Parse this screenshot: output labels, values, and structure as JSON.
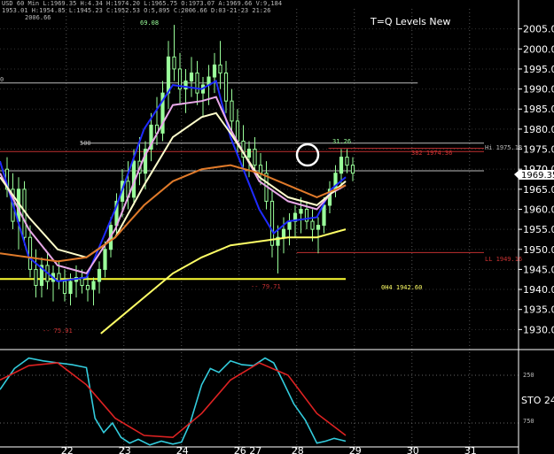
{
  "header": {
    "info_line": "USD 60 Min  L:1969.35  H:4.34  H:1974.20  L:1965.75  O:1973.07  A:1969.66  V:9,184",
    "info_line2": "1953.01  H:1954.85  L:1945.23  C:1952.53  O:5,895  C:2006.66  D:03-21-23  21:26",
    "study_title": "T=Q Levels New"
  },
  "annotations": {
    "top_left_value": "2006.66",
    "peak_value": "69.08",
    "level_500": "500",
    "level_left_top": "0",
    "low_value": "-- 75.91",
    "mid_label": "-- 79.71",
    "near_top_right": "31.26",
    "hh_label": "Hi 1975.18",
    "fib_label": "382 1974.36",
    "lo_label": "LL 1949.16",
    "pivot_label": "0H4 1942.60",
    "price_tag": "1969.35",
    "sto_label": "STO 24",
    "sto_level_top": "250",
    "sto_level_bottom": "750"
  },
  "colors": {
    "background": "#000000",
    "candle": "#9aff9a",
    "ema_blue": "#1f2bff",
    "ema_pink": "#e9a9e9",
    "ema_white": "#ffffcc",
    "ma_orange": "#e07a2a",
    "ma_yellow": "#ffff66",
    "level_red": "#c03030",
    "level_white": "#bbbbbb",
    "level_yellow": "#ffff33",
    "sto_cyan": "#33ccdd",
    "sto_red": "#dd2222"
  },
  "chart_data": [
    {
      "type": "line",
      "title": "T=Q Levels New",
      "ylim": [
        1925,
        2010
      ],
      "y_ticks": [
        1930,
        1935,
        1940,
        1945,
        1950,
        1955,
        1960,
        1965,
        1970,
        1975,
        1980,
        1985,
        1990,
        1995,
        2000,
        2005
      ],
      "y_tick_labels": [
        "1930.00",
        "1935.00",
        "1940.00",
        "1945.00",
        "1950.00",
        "1955.00",
        "1960.00",
        "1965.00",
        "1970.00",
        "1975.00",
        "1980.00",
        "1985.00",
        "1990.00",
        "1995.00",
        "2000.00",
        "2005.00"
      ],
      "x_ticks": [
        "22",
        "23",
        "24",
        "26 27",
        "28",
        "29",
        "30",
        "31"
      ],
      "x_tick_positions": [
        2.3,
        4.3,
        6.3,
        8.3,
        10.3,
        12.3,
        14.3,
        16.3
      ],
      "xlim": [
        0,
        18
      ],
      "candles": [
        {
          "x": 0.0,
          "o": 1970,
          "h": 1973,
          "l": 1963,
          "c": 1965
        },
        {
          "x": 0.2,
          "o": 1965,
          "h": 1969,
          "l": 1955,
          "c": 1957
        },
        {
          "x": 0.4,
          "o": 1957,
          "h": 1968,
          "l": 1950,
          "c": 1965
        },
        {
          "x": 0.6,
          "o": 1965,
          "h": 1967,
          "l": 1951,
          "c": 1953
        },
        {
          "x": 0.8,
          "o": 1953,
          "h": 1956,
          "l": 1943,
          "c": 1945
        },
        {
          "x": 1.0,
          "o": 1945,
          "h": 1950,
          "l": 1938,
          "c": 1941
        },
        {
          "x": 1.2,
          "o": 1941,
          "h": 1948,
          "l": 1938,
          "c": 1946
        },
        {
          "x": 1.4,
          "o": 1946,
          "h": 1949,
          "l": 1940,
          "c": 1942
        },
        {
          "x": 1.6,
          "o": 1942,
          "h": 1946,
          "l": 1937,
          "c": 1944
        },
        {
          "x": 1.8,
          "o": 1944,
          "h": 1947,
          "l": 1940,
          "c": 1942
        },
        {
          "x": 2.0,
          "o": 1942,
          "h": 1945,
          "l": 1937,
          "c": 1939
        },
        {
          "x": 2.2,
          "o": 1939,
          "h": 1944,
          "l": 1936,
          "c": 1942
        },
        {
          "x": 2.4,
          "o": 1942,
          "h": 1946,
          "l": 1938,
          "c": 1943
        },
        {
          "x": 2.6,
          "o": 1943,
          "h": 1945,
          "l": 1939,
          "c": 1941
        },
        {
          "x": 2.8,
          "o": 1941,
          "h": 1944,
          "l": 1937,
          "c": 1940
        },
        {
          "x": 3.0,
          "o": 1940,
          "h": 1943,
          "l": 1936,
          "c": 1942
        },
        {
          "x": 3.2,
          "o": 1942,
          "h": 1947,
          "l": 1939,
          "c": 1945
        },
        {
          "x": 3.4,
          "o": 1945,
          "h": 1952,
          "l": 1943,
          "c": 1950
        },
        {
          "x": 3.6,
          "o": 1950,
          "h": 1958,
          "l": 1948,
          "c": 1956
        },
        {
          "x": 3.8,
          "o": 1956,
          "h": 1964,
          "l": 1954,
          "c": 1962
        },
        {
          "x": 4.0,
          "o": 1962,
          "h": 1970,
          "l": 1958,
          "c": 1967
        },
        {
          "x": 4.2,
          "o": 1967,
          "h": 1972,
          "l": 1960,
          "c": 1963
        },
        {
          "x": 4.4,
          "o": 1963,
          "h": 1975,
          "l": 1961,
          "c": 1972
        },
        {
          "x": 4.6,
          "o": 1972,
          "h": 1978,
          "l": 1966,
          "c": 1969
        },
        {
          "x": 4.8,
          "o": 1969,
          "h": 1977,
          "l": 1965,
          "c": 1975
        },
        {
          "x": 5.0,
          "o": 1975,
          "h": 1984,
          "l": 1972,
          "c": 1981
        },
        {
          "x": 5.2,
          "o": 1981,
          "h": 1988,
          "l": 1976,
          "c": 1979
        },
        {
          "x": 5.4,
          "o": 1979,
          "h": 1992,
          "l": 1977,
          "c": 1989
        },
        {
          "x": 5.6,
          "o": 1989,
          "h": 2002,
          "l": 1985,
          "c": 1998
        },
        {
          "x": 5.8,
          "o": 1998,
          "h": 2006,
          "l": 1992,
          "c": 1995
        },
        {
          "x": 6.0,
          "o": 1995,
          "h": 1999,
          "l": 1986,
          "c": 1990
        },
        {
          "x": 6.2,
          "o": 1990,
          "h": 1995,
          "l": 1984,
          "c": 1992
        },
        {
          "x": 6.4,
          "o": 1992,
          "h": 1998,
          "l": 1988,
          "c": 1994
        },
        {
          "x": 6.6,
          "o": 1994,
          "h": 1997,
          "l": 1986,
          "c": 1989
        },
        {
          "x": 6.8,
          "o": 1989,
          "h": 1993,
          "l": 1983,
          "c": 1991
        },
        {
          "x": 7.0,
          "o": 1991,
          "h": 1996,
          "l": 1986,
          "c": 1993
        },
        {
          "x": 7.2,
          "o": 1993,
          "h": 1999,
          "l": 1989,
          "c": 1996
        },
        {
          "x": 7.4,
          "o": 1996,
          "h": 2002,
          "l": 1990,
          "c": 1994
        },
        {
          "x": 7.6,
          "o": 1994,
          "h": 1997,
          "l": 1984,
          "c": 1987
        },
        {
          "x": 7.8,
          "o": 1987,
          "h": 1990,
          "l": 1979,
          "c": 1982
        },
        {
          "x": 8.0,
          "o": 1982,
          "h": 1985,
          "l": 1974,
          "c": 1977
        },
        {
          "x": 8.2,
          "o": 1977,
          "h": 1981,
          "l": 1970,
          "c": 1973
        },
        {
          "x": 8.4,
          "o": 1973,
          "h": 1977,
          "l": 1968,
          "c": 1975
        },
        {
          "x": 8.6,
          "o": 1975,
          "h": 1978,
          "l": 1969,
          "c": 1971
        },
        {
          "x": 8.8,
          "o": 1971,
          "h": 1974,
          "l": 1966,
          "c": 1969
        },
        {
          "x": 9.0,
          "o": 1969,
          "h": 1972,
          "l": 1960,
          "c": 1962
        },
        {
          "x": 9.2,
          "o": 1962,
          "h": 1965,
          "l": 1948,
          "c": 1951
        },
        {
          "x": 9.4,
          "o": 1951,
          "h": 1956,
          "l": 1944,
          "c": 1953
        },
        {
          "x": 9.6,
          "o": 1953,
          "h": 1958,
          "l": 1949,
          "c": 1955
        },
        {
          "x": 9.8,
          "o": 1955,
          "h": 1959,
          "l": 1951,
          "c": 1957
        },
        {
          "x": 10.0,
          "o": 1957,
          "h": 1961,
          "l": 1953,
          "c": 1959
        },
        {
          "x": 10.2,
          "o": 1959,
          "h": 1963,
          "l": 1954,
          "c": 1960
        },
        {
          "x": 10.4,
          "o": 1960,
          "h": 1962,
          "l": 1955,
          "c": 1957
        },
        {
          "x": 10.6,
          "o": 1957,
          "h": 1960,
          "l": 1952,
          "c": 1955
        },
        {
          "x": 10.8,
          "o": 1955,
          "h": 1958,
          "l": 1949,
          "c": 1956
        },
        {
          "x": 11.0,
          "o": 1956,
          "h": 1963,
          "l": 1954,
          "c": 1961
        },
        {
          "x": 11.2,
          "o": 1961,
          "h": 1967,
          "l": 1959,
          "c": 1965
        },
        {
          "x": 11.4,
          "o": 1965,
          "h": 1971,
          "l": 1963,
          "c": 1969
        },
        {
          "x": 11.6,
          "o": 1969,
          "h": 1975,
          "l": 1966,
          "c": 1973
        },
        {
          "x": 11.8,
          "o": 1973,
          "h": 1975,
          "l": 1969,
          "c": 1971
        },
        {
          "x": 12.0,
          "o": 1971,
          "h": 1973,
          "l": 1967,
          "c": 1969
        }
      ],
      "series": [
        {
          "color_key": "ema_blue",
          "points": [
            [
              0,
              1972
            ],
            [
              1,
              1948
            ],
            [
              2,
              1942
            ],
            [
              3,
              1943
            ],
            [
              4,
              1960
            ],
            [
              5,
              1980
            ],
            [
              6,
              1991
            ],
            [
              7,
              1990
            ],
            [
              7.5,
              1992
            ],
            [
              8,
              1978
            ],
            [
              9,
              1960
            ],
            [
              9.5,
              1954
            ],
            [
              10,
              1957
            ],
            [
              11,
              1958
            ],
            [
              11.5,
              1965
            ],
            [
              12,
              1968
            ]
          ]
        },
        {
          "color_key": "ema_pink",
          "points": [
            [
              0,
              1969
            ],
            [
              1,
              1955
            ],
            [
              2,
              1946
            ],
            [
              3,
              1944
            ],
            [
              4,
              1955
            ],
            [
              5,
              1973
            ],
            [
              6,
              1986
            ],
            [
              7,
              1987
            ],
            [
              7.5,
              1988
            ],
            [
              8,
              1980
            ],
            [
              9,
              1967
            ],
            [
              10,
              1962
            ],
            [
              11,
              1960
            ],
            [
              11.5,
              1964
            ],
            [
              12,
              1966
            ]
          ]
        },
        {
          "color_key": "ema_white",
          "points": [
            [
              0,
              1968
            ],
            [
              1,
              1958
            ],
            [
              2,
              1950
            ],
            [
              3,
              1948
            ],
            [
              4,
              1953
            ],
            [
              5,
              1966
            ],
            [
              6,
              1978
            ],
            [
              7,
              1983
            ],
            [
              7.5,
              1984
            ],
            [
              8,
              1979
            ],
            [
              9,
              1968
            ],
            [
              10,
              1963
            ],
            [
              11,
              1961
            ],
            [
              11.5,
              1964
            ],
            [
              12,
              1967
            ]
          ]
        },
        {
          "color_key": "ma_orange",
          "points": [
            [
              0,
              1949
            ],
            [
              1,
              1948
            ],
            [
              2,
              1947
            ],
            [
              3,
              1948
            ],
            [
              4,
              1953
            ],
            [
              5,
              1961
            ],
            [
              6,
              1967
            ],
            [
              7,
              1970
            ],
            [
              8,
              1971
            ],
            [
              9,
              1969
            ],
            [
              10,
              1966
            ],
            [
              11,
              1963
            ],
            [
              12,
              1966
            ]
          ]
        },
        {
          "color_key": "ma_yellow",
          "points": [
            [
              3.5,
              1929
            ],
            [
              4,
              1932
            ],
            [
              5,
              1938
            ],
            [
              6,
              1944
            ],
            [
              7,
              1948
            ],
            [
              8,
              1951
            ],
            [
              9,
              1952
            ],
            [
              10,
              1953
            ],
            [
              11,
              1953
            ],
            [
              12,
              1955
            ]
          ]
        }
      ],
      "levels": [
        {
          "y": 1991.5,
          "x0": 0,
          "x1": 14.5,
          "color_key": "level_white",
          "width": 1
        },
        {
          "y": 1976.5,
          "x0": 2.8,
          "x1": 16.8,
          "color_key": "level_white",
          "width": 1
        },
        {
          "y": 1975.2,
          "x0": 11.4,
          "x1": 16.8,
          "color_key": "level_red",
          "width": 1
        },
        {
          "y": 1974.4,
          "x0": 0,
          "x1": 16.8,
          "color_key": "level_red",
          "width": 1
        },
        {
          "y": 1969.6,
          "x0": 0,
          "x1": 16.8,
          "color_key": "level_white",
          "width": 1
        },
        {
          "y": 1949.2,
          "x0": 10.3,
          "x1": 16.8,
          "color_key": "level_red",
          "width": 1
        },
        {
          "y": 1942.6,
          "x0": 0,
          "x1": 12.0,
          "color_key": "level_yellow",
          "width": 2
        }
      ]
    },
    {
      "type": "line",
      "title": "STO 24",
      "ylim": [
        0,
        1000
      ],
      "y_ticks": [
        250,
        750
      ],
      "y_tick_labels": [
        "250",
        "750"
      ],
      "series": [
        {
          "name": "STO",
          "color_key": "sto_cyan",
          "points": [
            [
              0,
              600
            ],
            [
              0.5,
              820
            ],
            [
              1,
              930
            ],
            [
              1.5,
              900
            ],
            [
              2,
              880
            ],
            [
              2.5,
              860
            ],
            [
              3,
              830
            ],
            [
              3.3,
              300
            ],
            [
              3.6,
              150
            ],
            [
              3.9,
              250
            ],
            [
              4.2,
              100
            ],
            [
              4.5,
              40
            ],
            [
              4.8,
              80
            ],
            [
              5.2,
              20
            ],
            [
              5.6,
              60
            ],
            [
              6,
              30
            ],
            [
              6.3,
              50
            ],
            [
              6.6,
              250
            ],
            [
              7,
              650
            ],
            [
              7.3,
              820
            ],
            [
              7.6,
              780
            ],
            [
              8,
              900
            ],
            [
              8.4,
              860
            ],
            [
              8.8,
              850
            ],
            [
              9.2,
              930
            ],
            [
              9.5,
              880
            ],
            [
              9.8,
              700
            ],
            [
              10.2,
              450
            ],
            [
              10.6,
              280
            ],
            [
              11,
              40
            ],
            [
              11.3,
              60
            ],
            [
              11.6,
              90
            ],
            [
              12,
              60
            ]
          ]
        },
        {
          "name": "Signal",
          "color_key": "sto_red",
          "points": [
            [
              0,
              700
            ],
            [
              1,
              850
            ],
            [
              2,
              880
            ],
            [
              3,
              650
            ],
            [
              4,
              300
            ],
            [
              5,
              120
            ],
            [
              6,
              100
            ],
            [
              7,
              350
            ],
            [
              8,
              700
            ],
            [
              9,
              880
            ],
            [
              10,
              750
            ],
            [
              11,
              350
            ],
            [
              12,
              120
            ]
          ]
        }
      ]
    }
  ]
}
